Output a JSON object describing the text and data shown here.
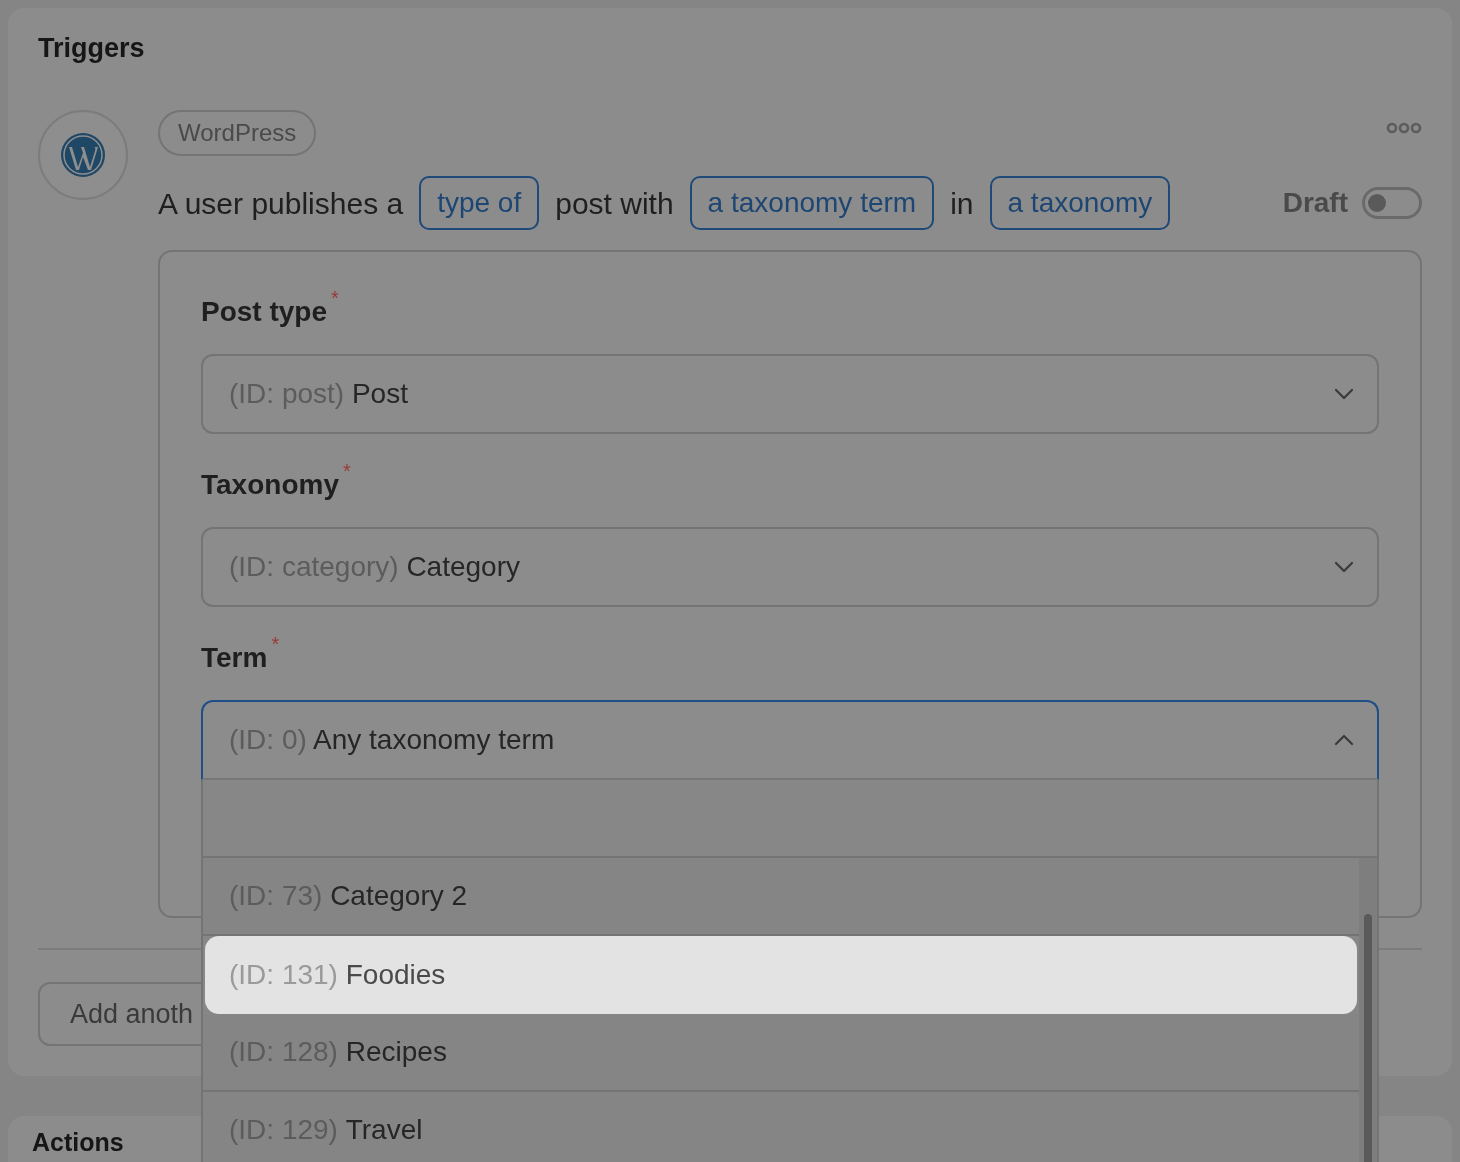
{
  "triggers": {
    "title": "Triggers",
    "integration": "WordPress",
    "sentence": [
      {
        "kind": "text",
        "text": "A user publishes a"
      },
      {
        "kind": "token",
        "text": "type of"
      },
      {
        "kind": "text",
        "text": "post with"
      },
      {
        "kind": "token",
        "text": "a taxonomy term"
      },
      {
        "kind": "text",
        "text": "in"
      },
      {
        "kind": "token",
        "text": "a taxonomy"
      }
    ],
    "status": {
      "label": "Draft",
      "on": false
    },
    "fields": [
      {
        "label": "Post type",
        "required": true,
        "id_part": "(ID: post)",
        "value": "Post",
        "expanded": false
      },
      {
        "label": "Taxonomy",
        "required": true,
        "id_part": "(ID: category)",
        "value": "Category",
        "expanded": false
      },
      {
        "label": "Term",
        "required": true,
        "id_part": "(ID: 0)",
        "value": "Any taxonomy term",
        "expanded": true
      }
    ],
    "required_mark": "*",
    "dropdown": {
      "options": [
        {
          "id_part": "(ID: 73)",
          "label": "Category 2",
          "selected": false
        },
        {
          "id_part": "(ID: 131)",
          "label": "Foodies",
          "selected": true
        },
        {
          "id_part": "(ID: 128)",
          "label": "Recipes",
          "selected": false
        },
        {
          "id_part": "(ID: 129)",
          "label": "Travel",
          "selected": false
        }
      ]
    },
    "add_button": "Add anoth"
  },
  "actions": {
    "title": "Actions"
  }
}
